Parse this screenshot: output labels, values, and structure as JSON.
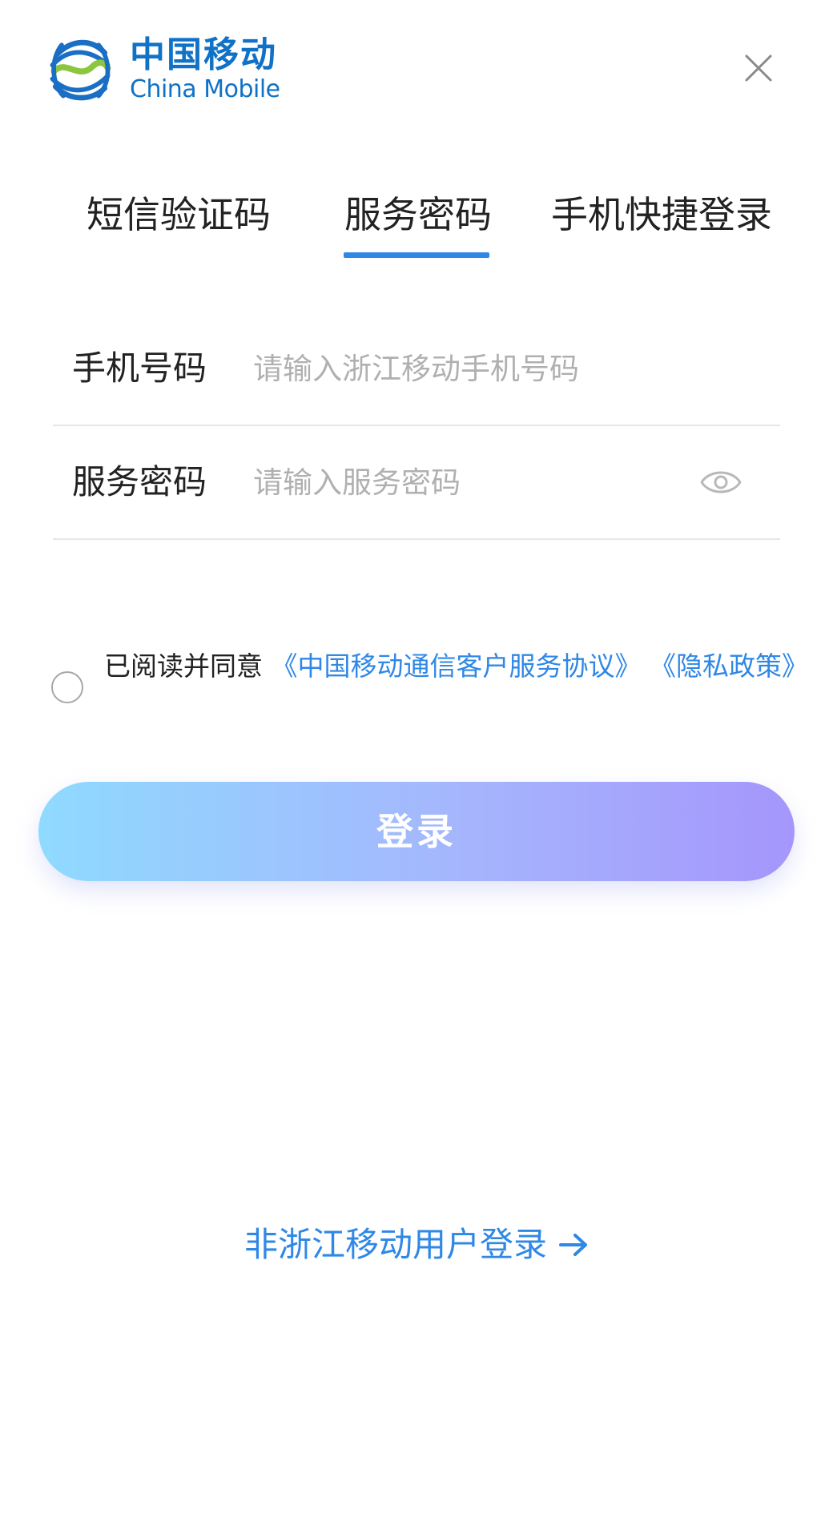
{
  "header": {
    "brand_cn": "中国移动",
    "brand_en": "China Mobile",
    "logo_icon": "china-mobile-logo-icon",
    "close_icon": "close-icon"
  },
  "tabs": [
    {
      "label": "短信验证码",
      "active": false
    },
    {
      "label": "服务密码",
      "active": true
    },
    {
      "label": "手机快捷登录",
      "active": false
    }
  ],
  "form": {
    "phone": {
      "label": "手机号码",
      "placeholder": "请输入浙江移动手机号码",
      "value": ""
    },
    "password": {
      "label": "服务密码",
      "placeholder": "请输入服务密码",
      "value": "",
      "toggle_icon": "eye-icon"
    }
  },
  "agreement": {
    "checked": false,
    "prefix": "已阅读并同意",
    "link1": "《中国移动通信客户服务协议》",
    "link2": "《隐私政策》"
  },
  "login_button": "登录",
  "other_login": {
    "label": "非浙江移动用户登录",
    "icon": "arrow-right-icon"
  },
  "colors": {
    "brand_blue": "#0f72c7",
    "accent_blue": "#2f88e6",
    "button_gradient_start": "#8fdaff",
    "button_gradient_end": "#a596fc",
    "divider": "#e6e6e6",
    "placeholder": "#b0b0b0"
  }
}
